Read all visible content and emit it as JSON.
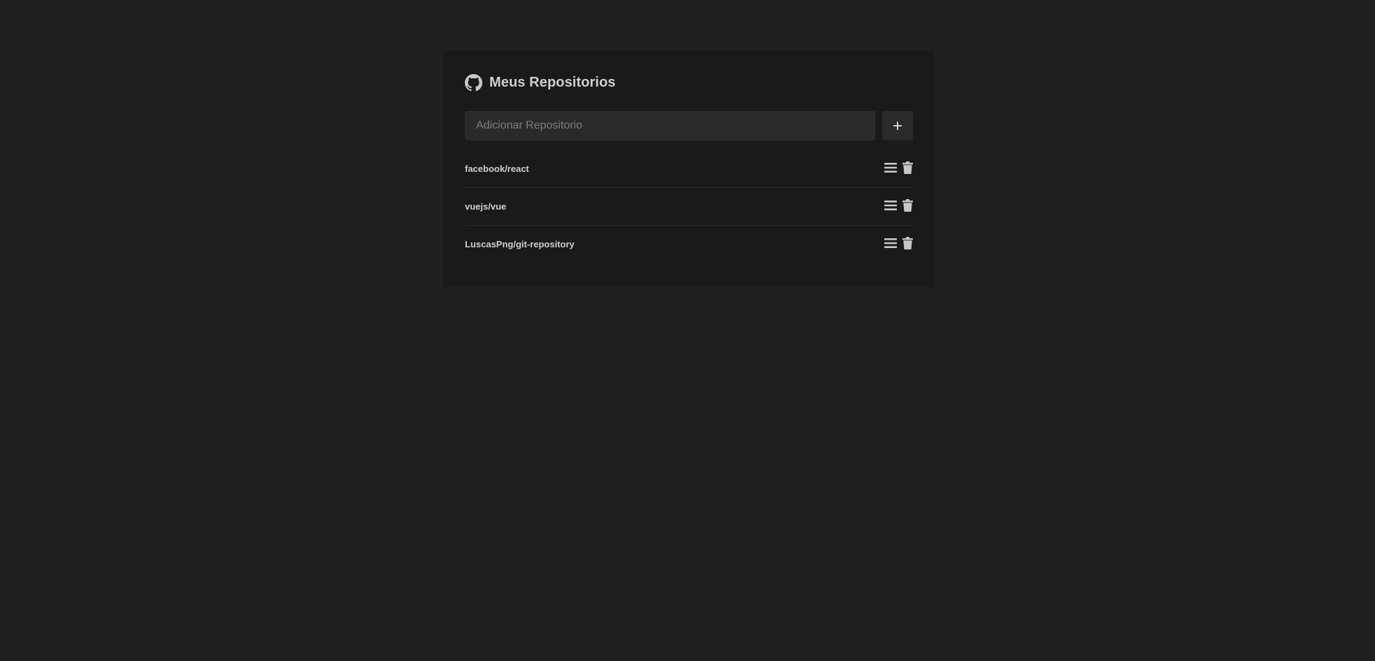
{
  "header": {
    "title": "Meus Repositorios",
    "icon": "github-icon"
  },
  "form": {
    "input_placeholder": "Adicionar Repositorio",
    "input_value": "",
    "add_icon": "plus-icon"
  },
  "repositories": [
    {
      "name": "facebook/react",
      "detail_icon": "list-icon",
      "delete_icon": "trash-icon"
    },
    {
      "name": "vuejs/vue",
      "detail_icon": "list-icon",
      "delete_icon": "trash-icon"
    },
    {
      "name": "LuscasPng/git-repository",
      "detail_icon": "list-icon",
      "delete_icon": "trash-icon"
    }
  ],
  "colors": {
    "page_background": "#202020",
    "panel_background": "#1a1a1a",
    "input_background": "#2a2a2a",
    "text": "#cfcfcf",
    "icon": "#c8c8c8"
  }
}
